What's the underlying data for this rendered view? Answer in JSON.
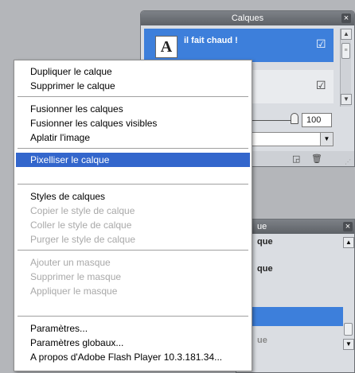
{
  "layers_panel": {
    "title": "Calques",
    "close_label": "×",
    "layers": [
      {
        "thumb": "A",
        "name": "il fait chaud !",
        "visible_mark": "☑",
        "selected": true
      },
      {
        "thumb": "",
        "name": "",
        "visible_mark": "☑",
        "selected": false
      }
    ],
    "opacity_value": "100",
    "icons": [
      "new-layer-icon",
      "trash-icon"
    ]
  },
  "lower_panel": {
    "title_fragment": "ue",
    "close_label": "×",
    "lines": [
      "que",
      "que",
      "ue"
    ]
  },
  "context_menu": {
    "items": [
      {
        "label": "Dupliquer le calque",
        "enabled": true
      },
      {
        "label": "Supprimer le calque",
        "enabled": true
      },
      {
        "label": "Fusionner les calques",
        "enabled": true
      },
      {
        "label": "Fusionner les calques visibles",
        "enabled": true
      },
      {
        "label": "Aplatir l'image",
        "enabled": true
      },
      {
        "label": "Pixelliser le calque",
        "enabled": true,
        "highlighted": true
      },
      {
        "label": "Styles de calques",
        "enabled": true
      },
      {
        "label": "Copier le style de calque",
        "enabled": false
      },
      {
        "label": "Coller le style de calque",
        "enabled": false
      },
      {
        "label": "Purger le style de calque",
        "enabled": false
      },
      {
        "label": "Ajouter un masque",
        "enabled": false
      },
      {
        "label": "Supprimer le masque",
        "enabled": false
      },
      {
        "label": "Appliquer le masque",
        "enabled": false
      },
      {
        "label": "Paramètres...",
        "enabled": true
      },
      {
        "label": "Paramètres globaux...",
        "enabled": true
      },
      {
        "label": "A propos d'Adobe Flash Player 10.3.181.34...",
        "enabled": true
      }
    ]
  },
  "colors": {
    "selection_blue": "#3d7fdb",
    "menu_highlight": "#3366cc",
    "disabled_text": "#a9a9a9",
    "panel_bg": "#dadde2",
    "titlebar": "#6b6f74"
  }
}
